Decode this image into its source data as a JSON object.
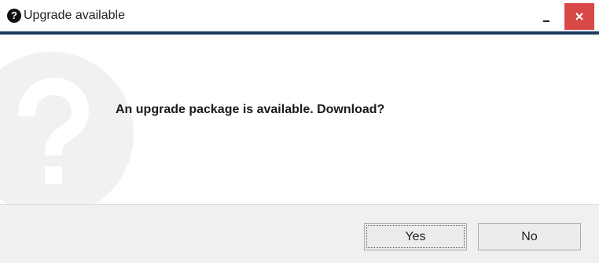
{
  "window": {
    "title": "Upgrade available",
    "title_icon": "question-circle-icon",
    "minimize_icon": "minimize-icon",
    "close_icon": "close-icon",
    "accent_color": "#1e3a5f",
    "close_color": "#d84847"
  },
  "dialog": {
    "watermark_icon": "question-mark-watermark-icon",
    "title_icon_glyph": "?",
    "message": "An upgrade package is available. Download?"
  },
  "buttons": {
    "yes_label": "Yes",
    "no_label": "No"
  }
}
